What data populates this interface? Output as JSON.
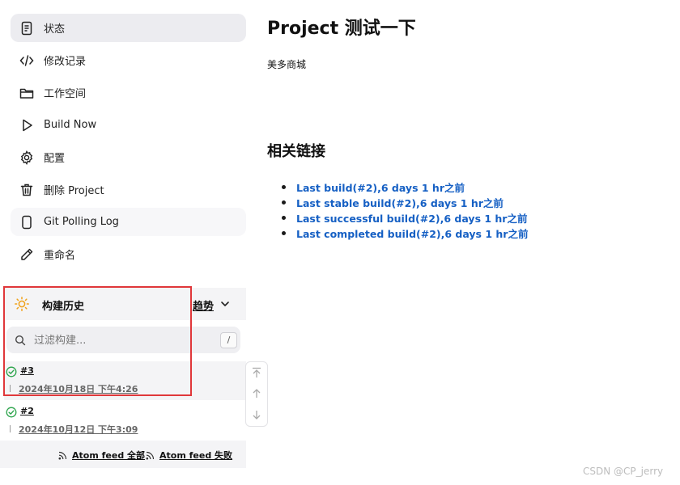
{
  "sidebar": {
    "items": [
      {
        "label": "状态",
        "icon": "document-icon"
      },
      {
        "label": "修改记录",
        "icon": "code-icon"
      },
      {
        "label": "工作空间",
        "icon": "folder-icon"
      },
      {
        "label": "Build Now",
        "icon": "play-icon"
      },
      {
        "label": "配置",
        "icon": "gear-icon"
      },
      {
        "label": "删除 Project",
        "icon": "trash-icon"
      },
      {
        "label": "Git Polling Log",
        "icon": "file-icon"
      },
      {
        "label": "重命名",
        "icon": "pencil-icon"
      }
    ]
  },
  "history": {
    "title": "构建历史",
    "trend": "趋势",
    "filter_placeholder": "过滤构建...",
    "shortcut": "/",
    "builds": [
      {
        "number": "#3",
        "date": "2024年10月18日 下午4:26",
        "status": "success"
      },
      {
        "number": "#2",
        "date": "2024年10月12日 下午3:09",
        "status": "success"
      }
    ],
    "feeds": {
      "all": "Atom feed 全部",
      "failed": "Atom feed 失败"
    }
  },
  "main": {
    "title": "Project 测试一下",
    "description": "美多商城",
    "links_heading": "相关链接",
    "links": [
      "Last build(#2),6 days 1 hr之前",
      "Last stable build(#2),6 days 1 hr之前",
      "Last successful build(#2),6 days 1 hr之前",
      "Last completed build(#2),6 days 1 hr之前"
    ]
  },
  "watermark": "CSDN @CP_jerry",
  "colors": {
    "link": "#1660c4",
    "success": "#2aa34a",
    "highlight_border": "#e0373a",
    "active_bg": "#ececf0"
  }
}
